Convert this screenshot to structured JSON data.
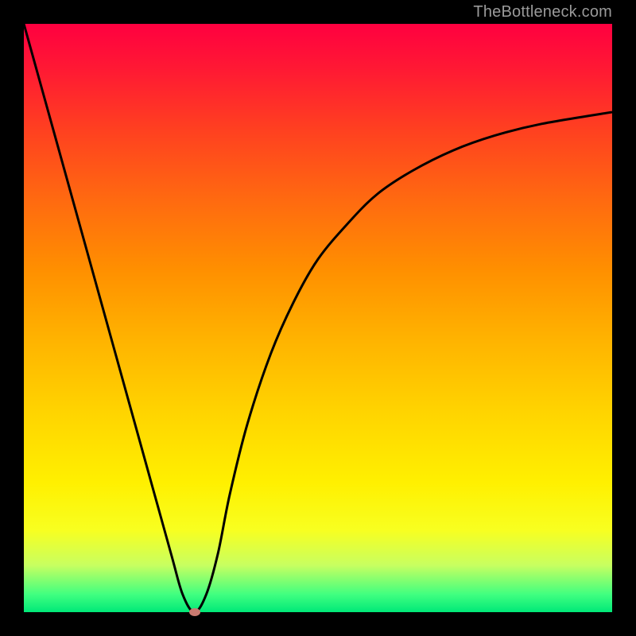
{
  "watermark": "TheBottleneck.com",
  "chart_data": {
    "type": "line",
    "title": "",
    "xlabel": "",
    "ylabel": "",
    "xlim": [
      0,
      100
    ],
    "ylim": [
      0,
      100
    ],
    "grid": false,
    "legend": false,
    "series": [
      {
        "name": "bottleneck-curve",
        "x": [
          0,
          5,
          10,
          15,
          20,
          25,
          27,
          29,
          31,
          33,
          35,
          38,
          42,
          46,
          50,
          55,
          60,
          66,
          73,
          80,
          88,
          100
        ],
        "values": [
          100,
          82,
          64,
          46,
          28,
          10,
          3,
          0,
          3,
          10,
          20,
          32,
          44,
          53,
          60,
          66,
          71,
          75,
          78.5,
          81,
          83,
          85
        ]
      }
    ],
    "marker": {
      "x": 29,
      "y": 0
    },
    "background_gradient": {
      "top": "#ff0040",
      "bottom": "#00e878"
    }
  }
}
